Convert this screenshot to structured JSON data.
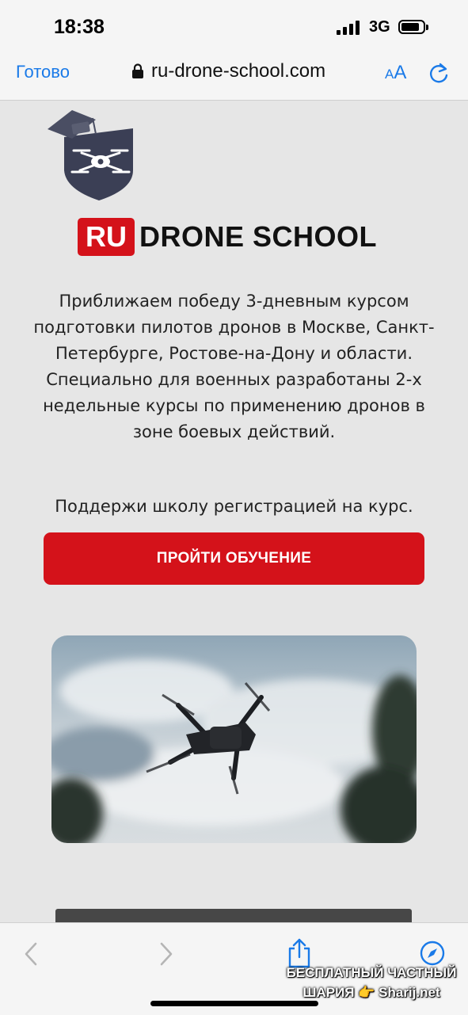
{
  "status_bar": {
    "time": "18:38",
    "network": "3G"
  },
  "browser": {
    "done_label": "Готово",
    "url": "ru-drone-school.com",
    "text_size_small": "A",
    "text_size_large": "A"
  },
  "brand": {
    "ru": "RU",
    "name": "DRONE SCHOOL"
  },
  "main": {
    "description": "Приближаем победу 3-дневным курсом подготовки пилотов дронов в Москве, Санкт-Петербурге, Ростове-на-Дону и области. Специально для военных разработаны 2-х недельные курсы по применению дронов в зоне боевых действий.",
    "support_text": "Поддержи школу регистрацией на курс.",
    "cta_label": "ПРОЙТИ ОБУЧЕНИЕ"
  },
  "watermark": {
    "line1": "БЕСПЛАТНЫЙ ЧАСТНЫЙ",
    "line2": "ШАРИЯ 👉 Sharij.net"
  },
  "colors": {
    "accent": "#d4121a",
    "link": "#1a7ae8",
    "badge": "#3b3f55"
  }
}
